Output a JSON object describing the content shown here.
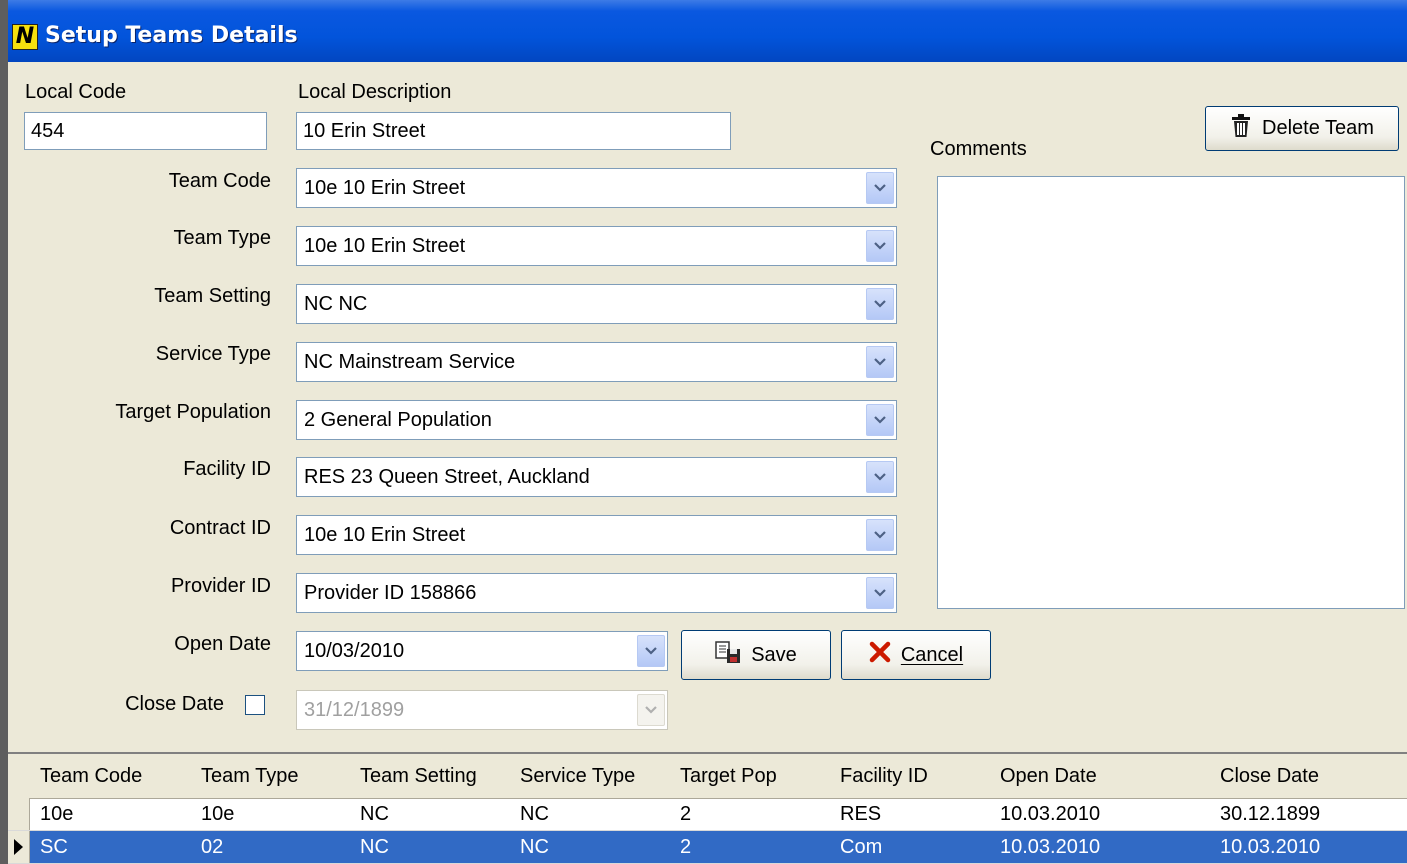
{
  "window": {
    "title": "Setup Teams Details"
  },
  "labels": {
    "local_code": "Local Code",
    "local_description": "Local Description",
    "comments": "Comments",
    "team_code": "Team Code",
    "team_type": "Team Type",
    "team_setting": "Team Setting",
    "service_type": "Service Type",
    "target_population": "Target Population",
    "facility_id": "Facility ID",
    "contract_id": "Contract ID",
    "provider_id": "Provider ID",
    "open_date": "Open Date",
    "close_date": "Close Date"
  },
  "fields": {
    "local_code": "454",
    "local_description": "10 Erin Street",
    "comments": "",
    "team_code": "10e 10 Erin Street",
    "team_type": "10e 10 Erin Street",
    "team_setting": "NC NC",
    "service_type": "NC Mainstream Service",
    "target_population": "2 General Population",
    "facility_id": "RES 23 Queen Street, Auckland",
    "contract_id": "10e 10 Erin Street",
    "provider_id": "Provider ID 158866",
    "open_date": "10/03/2010",
    "close_date": "31/12/1899",
    "close_date_checked": false
  },
  "buttons": {
    "delete_team": "Delete Team",
    "save": "Save",
    "cancel": "Cancel"
  },
  "grid": {
    "columns": [
      "Team Code",
      "Team Type",
      "Team Setting",
      "Service Type",
      "Target Pop",
      "Facility ID",
      "Open Date",
      "Close Date"
    ],
    "rows": [
      [
        "10e",
        "10e",
        "NC",
        "NC",
        "2",
        "RES",
        "10.03.2010",
        "30.12.1899"
      ],
      [
        "SC",
        "02",
        "NC",
        "NC",
        "2",
        "Com",
        "10.03.2010",
        "10.03.2010"
      ]
    ],
    "selected_row": 1
  },
  "colors": {
    "titlebar": "#0254db",
    "form_background": "#ece9d8",
    "selection": "#316ac5",
    "cancel_icon": "#cc1a00"
  },
  "icons": {
    "app": "n-logo-icon",
    "delete": "trash-icon",
    "save": "save-icon",
    "cancel": "cancel-x-icon",
    "dropdown": "chevron-down-icon",
    "row_indicator": "row-pointer-icon"
  }
}
